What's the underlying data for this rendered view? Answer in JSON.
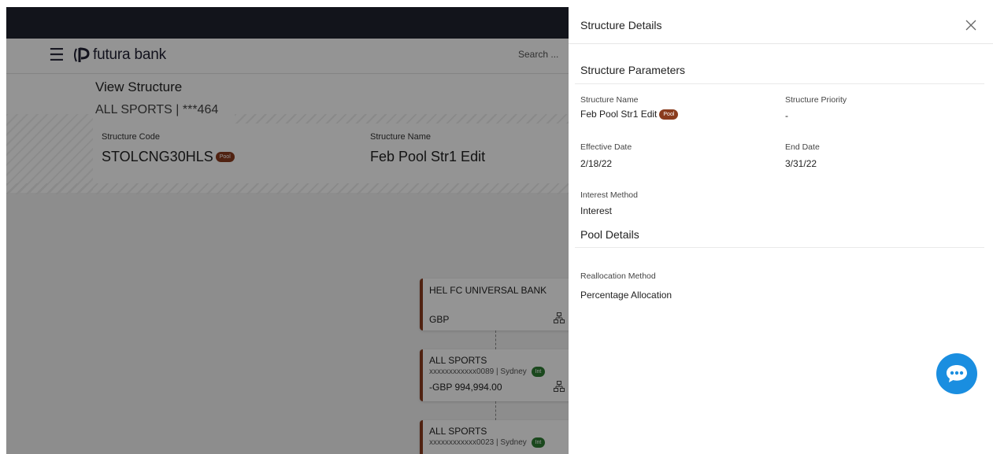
{
  "header": {
    "brand": "futura bank",
    "search_placeholder": "Search ..."
  },
  "structure": {
    "view_title": "View Structure",
    "subtitle": "ALL SPORTS | ***464",
    "code_label": "Structure Code",
    "code_value": "STOLCNG30HLS",
    "pool_badge": "Pool",
    "name_label": "Structure Name",
    "name_value": "Feb Pool Str1 Edit"
  },
  "tree": {
    "nodes": [
      {
        "title": "HEL FC UNIVERSAL BANK",
        "subtitle": "",
        "badge": "",
        "balance": "GBP"
      },
      {
        "title": "ALL SPORTS",
        "subtitle": "xxxxxxxxxxxx0089 | Sydney",
        "badge": "Int",
        "balance": "-GBP 994,994.00"
      },
      {
        "title": "ALL SPORTS",
        "subtitle": "xxxxxxxxxxxx0023 | Sydney",
        "badge": "Int",
        "balance": ""
      }
    ]
  },
  "drawer": {
    "title": "Structure Details",
    "params_title": "Structure Parameters",
    "fields": {
      "structure_name_label": "Structure Name",
      "structure_name_value": "Feb Pool Str1 Edit",
      "pool_badge": "Pool",
      "priority_label": "Structure Priority",
      "priority_value": "-",
      "effective_date_label": "Effective Date",
      "effective_date_value": "2/18/22",
      "end_date_label": "End Date",
      "end_date_value": "3/31/22",
      "interest_method_label": "Interest Method",
      "interest_method_value": "Interest"
    },
    "pool_title": "Pool Details",
    "pool_fields": {
      "reallocation_label": "Reallocation Method",
      "reallocation_value": "Percentage Allocation"
    }
  },
  "colors": {
    "topbar": "#1f2330",
    "pool_badge": "#8a3c1e",
    "int_badge": "#2e7d32",
    "chat": "#1a8ee0"
  }
}
